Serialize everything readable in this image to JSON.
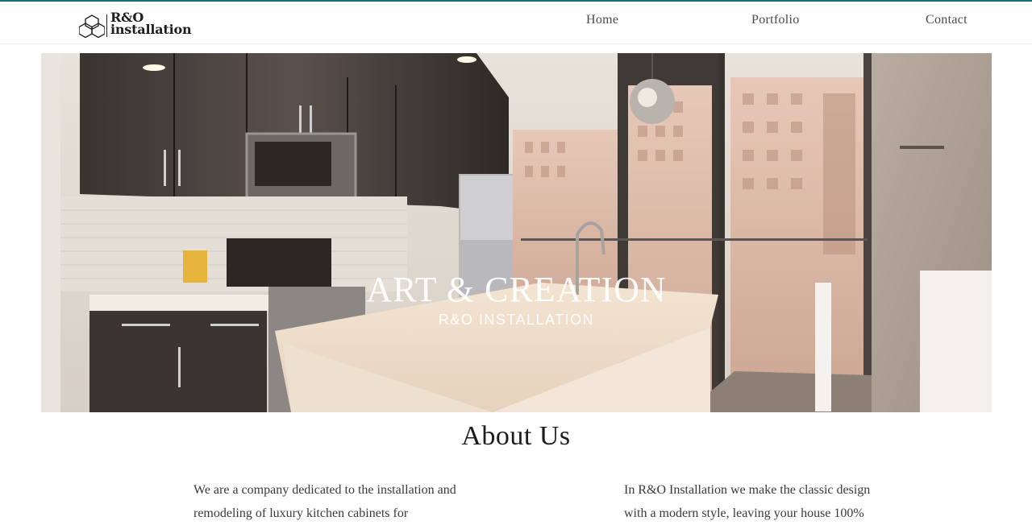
{
  "header": {
    "brand_line1": "R&O",
    "brand_line2": "installation",
    "nav": [
      {
        "label": "Home"
      },
      {
        "label": "Portfolio"
      },
      {
        "label": "Contact"
      }
    ]
  },
  "hero": {
    "title": "ART & CREATION",
    "subtitle": "R&O INSTALLATION"
  },
  "about": {
    "title": "About Us",
    "left_text": "We are a company dedicated to the installation and remodeling of luxury kitchen cabinets for",
    "right_text": "In R&O Installation we make the classic design with a modern style, leaving your house 100%"
  },
  "colors": {
    "accent_top_border": "#1e6f72",
    "text": "#2a2a2a"
  }
}
